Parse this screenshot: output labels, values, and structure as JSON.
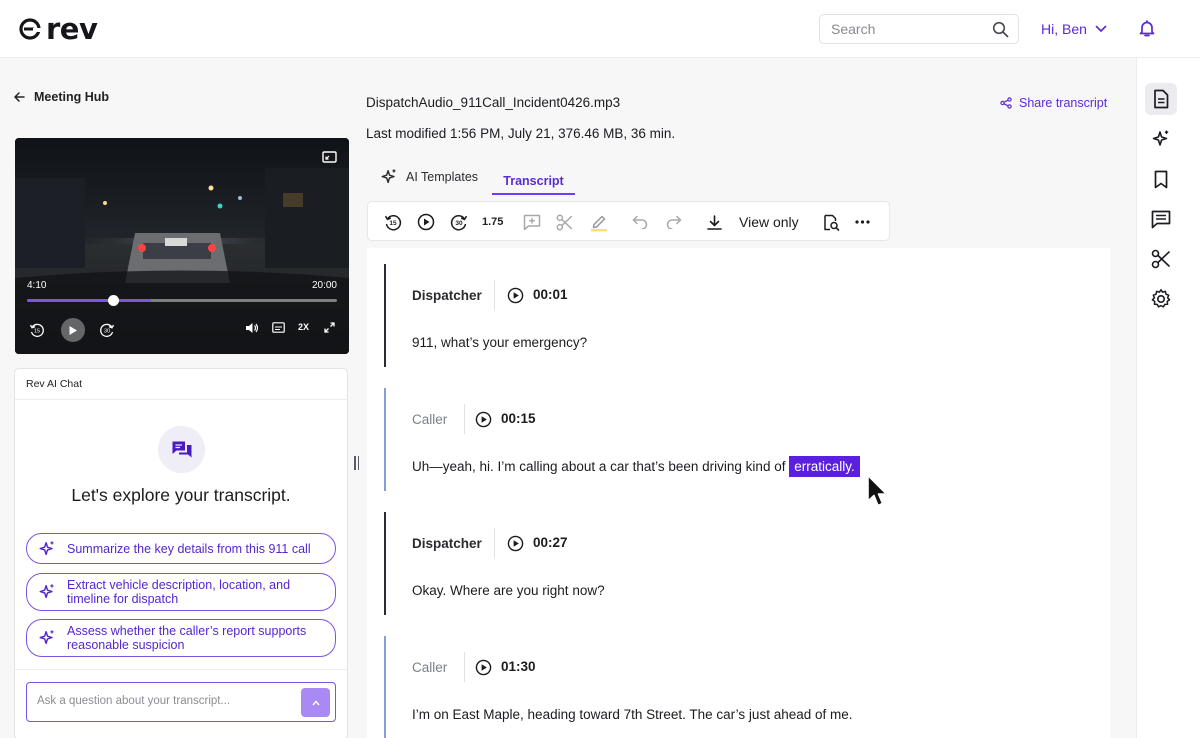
{
  "header": {
    "brand": "rev",
    "search_placeholder": "Search",
    "user_greeting": "Hi, Ben"
  },
  "colors": {
    "accent": "#6e3ff2",
    "accent_text": "#5b2bd6",
    "highlight": "#5b1fe0"
  },
  "nav": {
    "back_label": "Meeting Hub"
  },
  "video": {
    "current_time": "4:10",
    "duration": "20:00",
    "progress": 0.28,
    "buffered": 0.4,
    "speed_label": "2X"
  },
  "chat": {
    "title": "Rev AI Chat",
    "heading": "Let's explore your transcript.",
    "suggestions": [
      "Summarize the key details from this 911 call",
      "Extract vehicle description, location, and timeline for dispatch",
      "Assess whether the caller’s report supports reasonable suspicion"
    ],
    "input_placeholder": "Ask a question about your transcript..."
  },
  "file": {
    "name": "DispatchAudio_911Call_Incident0426.mp3",
    "meta": "Last modified 1:56 PM, July 21, 376.46 MB, 36 min.",
    "share_label": "Share transcript"
  },
  "tabs": [
    {
      "label": "AI Templates",
      "active": false
    },
    {
      "label": "Transcript",
      "active": true
    }
  ],
  "toolbar": {
    "speed": "1.75",
    "view_mode": "View only",
    "skip_back": "15",
    "skip_forward": "30"
  },
  "transcript": [
    {
      "speaker": "Dispatcher",
      "time": "00:01",
      "text": "911, what’s your emergency?",
      "highlight": ""
    },
    {
      "speaker": "Caller",
      "time": "00:15",
      "text": "Uh—yeah, hi. I’m calling about a car that’s been driving kind of",
      "highlight": "erratically."
    },
    {
      "speaker": "Dispatcher",
      "time": "00:27",
      "text": "Okay. Where are you right now?",
      "highlight": ""
    },
    {
      "speaker": "Caller",
      "time": "01:30",
      "text": "I’m on East Maple, heading toward 7th Street. The car’s just ahead of me.",
      "highlight": ""
    }
  ]
}
